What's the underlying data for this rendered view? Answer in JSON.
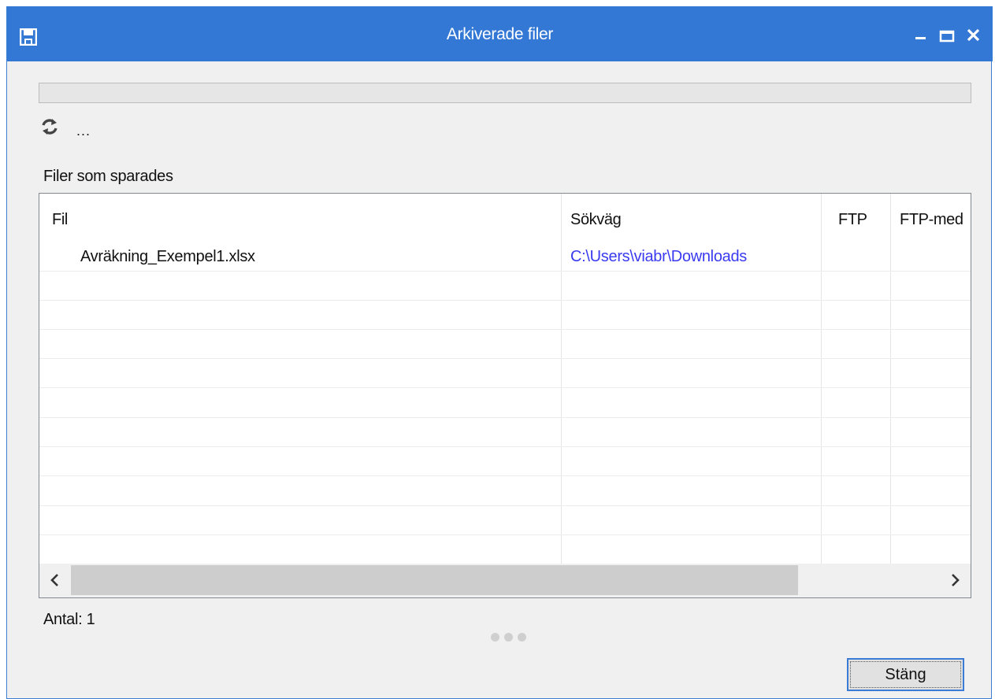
{
  "window": {
    "title": "Arkiverade filer",
    "accent_color": "#3478d6",
    "title_icon": "floppy-disk-icon",
    "controls": [
      "minimize-icon",
      "maximize-icon",
      "close-icon"
    ]
  },
  "progress": {
    "value": 0
  },
  "status": {
    "icon": "refresh-icon",
    "text": "..."
  },
  "files_group": {
    "label": "Filer som sparades",
    "columns": [
      {
        "label": "Fil"
      },
      {
        "label": "Sökväg"
      },
      {
        "label": "FTP"
      },
      {
        "label": "FTP-med"
      }
    ],
    "rows": [
      {
        "file": "Avräkning_Exempel1.xlsx",
        "path": "C:\\Users\\viabr\\Downloads",
        "ftp": "",
        "ftp_message": ""
      }
    ],
    "path_color": "#3a3af0"
  },
  "count_label": "Antal: 1",
  "close_button_label": "Stäng"
}
